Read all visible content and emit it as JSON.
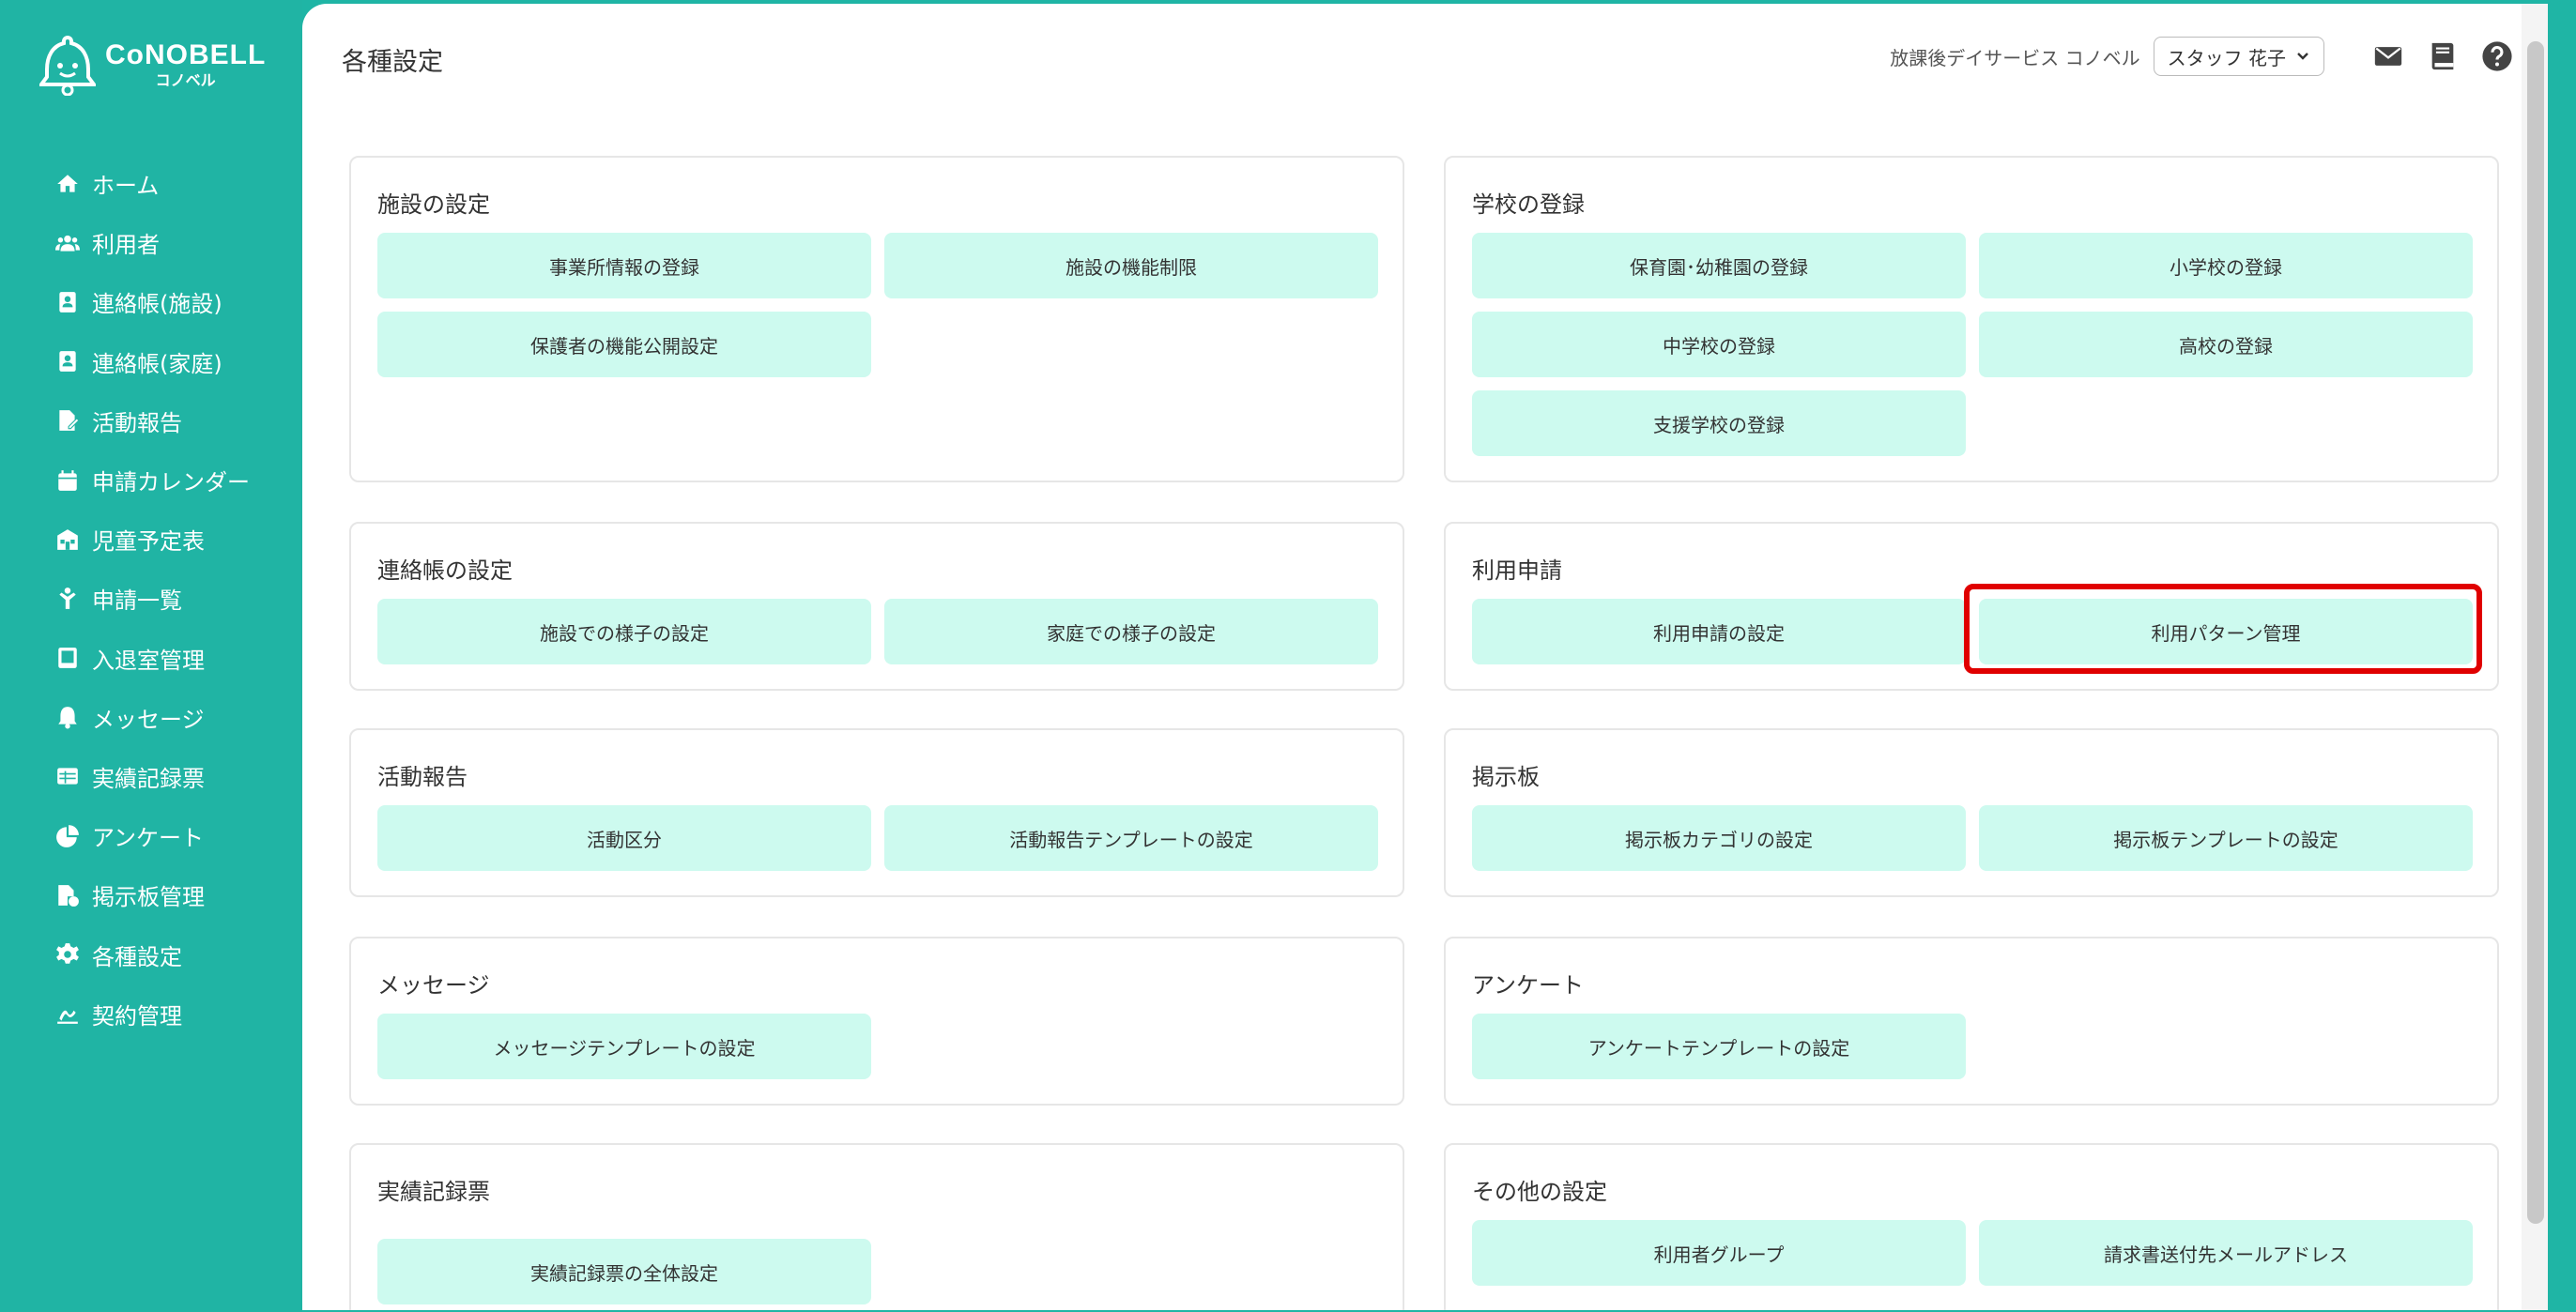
{
  "brand": {
    "name": "CoNOBELL",
    "sub": "コノベル"
  },
  "sidebar": {
    "items": [
      {
        "label": "ホーム",
        "icon": "home-icon"
      },
      {
        "label": "利用者",
        "icon": "users-icon"
      },
      {
        "label": "連絡帳(施設)",
        "icon": "contact-book-icon"
      },
      {
        "label": "連絡帳(家庭)",
        "icon": "contact-book-icon"
      },
      {
        "label": "活動報告",
        "icon": "report-icon"
      },
      {
        "label": "申請カレンダー",
        "icon": "calendar-icon"
      },
      {
        "label": "児童予定表",
        "icon": "schedule-icon"
      },
      {
        "label": "申請一覧",
        "icon": "child-icon"
      },
      {
        "label": "入退室管理",
        "icon": "tablet-icon"
      },
      {
        "label": "メッセージ",
        "icon": "bell-icon"
      },
      {
        "label": "実績記録票",
        "icon": "table-icon"
      },
      {
        "label": "アンケート",
        "icon": "pie-icon"
      },
      {
        "label": "掲示板管理",
        "icon": "board-icon"
      },
      {
        "label": "各種設定",
        "icon": "gear-icon"
      },
      {
        "label": "契約管理",
        "icon": "contract-icon"
      }
    ]
  },
  "header": {
    "title": "各種設定",
    "facility": "放課後デイサービス コノベル",
    "user": "スタッフ 花子"
  },
  "sections": {
    "facility": {
      "title": "施設の設定",
      "buttons": [
        "事業所情報の登録",
        "施設の機能制限",
        "保護者の機能公開設定"
      ]
    },
    "school": {
      "title": "学校の登録",
      "buttons": [
        "保育園･幼稚園の登録",
        "小学校の登録",
        "中学校の登録",
        "高校の登録",
        "支援学校の登録"
      ]
    },
    "contact": {
      "title": "連絡帳の設定",
      "buttons": [
        "施設での様子の設定",
        "家庭での様子の設定"
      ]
    },
    "usage": {
      "title": "利用申請",
      "buttons": [
        "利用申請の設定",
        "利用パターン管理"
      ]
    },
    "activity": {
      "title": "活動報告",
      "buttons": [
        "活動区分",
        "活動報告テンプレートの設定"
      ]
    },
    "board": {
      "title": "掲示板",
      "buttons": [
        "掲示板カテゴリの設定",
        "掲示板テンプレートの設定"
      ]
    },
    "message": {
      "title": "メッセージ",
      "buttons": [
        "メッセージテンプレートの設定"
      ]
    },
    "survey": {
      "title": "アンケート",
      "buttons": [
        "アンケートテンプレートの設定"
      ]
    },
    "record": {
      "title": "実績記録票",
      "buttons": [
        "実績記録票の全体設定"
      ]
    },
    "other": {
      "title": "その他の設定",
      "buttons": [
        "利用者グループ",
        "請求書送付先メールアドレス"
      ]
    }
  },
  "colors": {
    "accent": "#20b4a4",
    "button_bg": "#cdfaef",
    "highlight": "#e00000"
  }
}
